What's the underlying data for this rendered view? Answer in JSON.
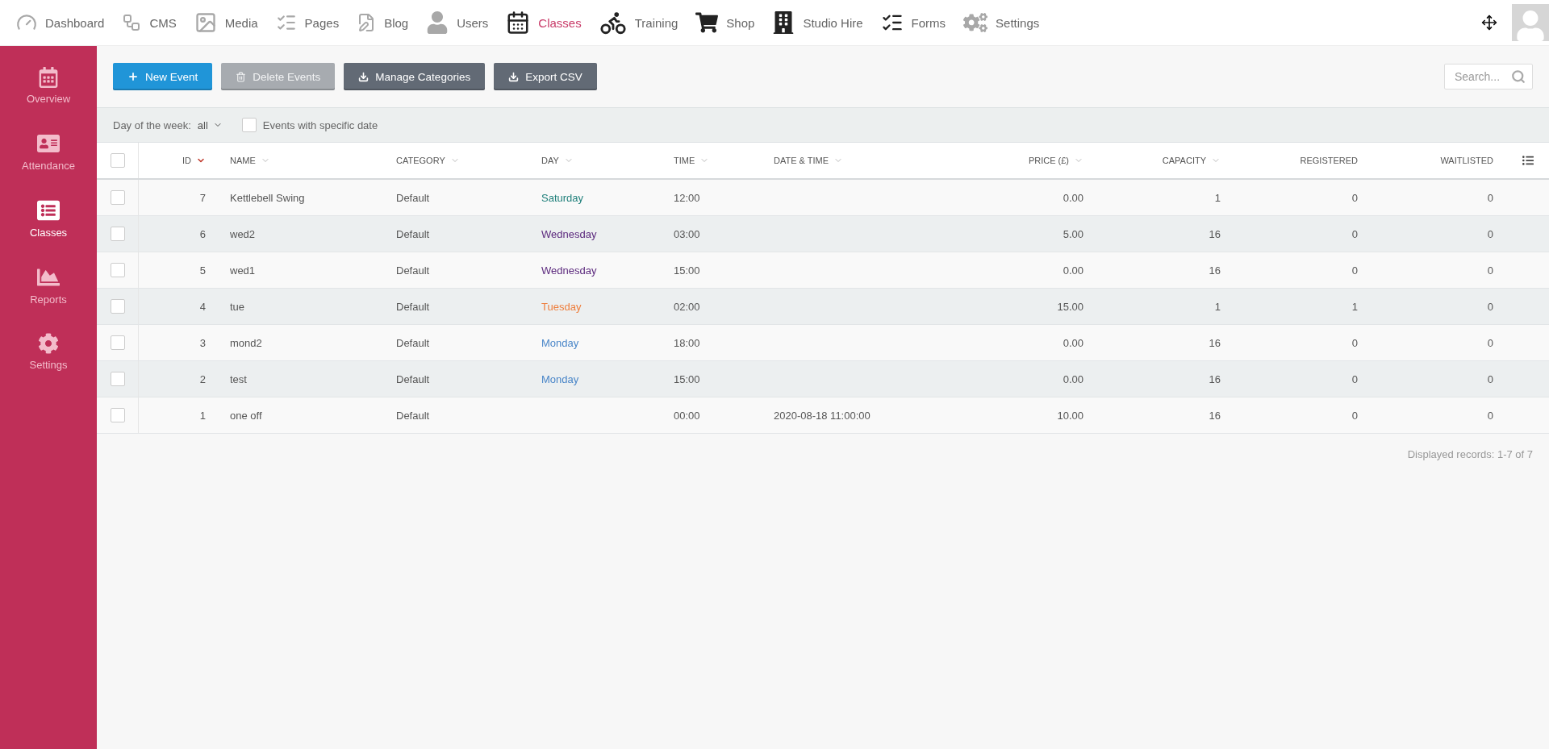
{
  "top_nav": {
    "items": [
      {
        "label": "Dashboard",
        "selected": false
      },
      {
        "label": "CMS",
        "selected": false
      },
      {
        "label": "Media",
        "selected": false
      },
      {
        "label": "Pages",
        "selected": false
      },
      {
        "label": "Blog",
        "selected": false
      },
      {
        "label": "Users",
        "selected": false
      },
      {
        "label": "Classes",
        "selected": true
      },
      {
        "label": "Training",
        "selected": false
      },
      {
        "label": "Shop",
        "selected": false
      },
      {
        "label": "Studio Hire",
        "selected": false
      },
      {
        "label": "Forms",
        "selected": false
      },
      {
        "label": "Settings",
        "selected": false
      }
    ]
  },
  "sidebar": {
    "items": [
      {
        "label": "Overview",
        "selected": false
      },
      {
        "label": "Attendance",
        "selected": false
      },
      {
        "label": "Classes",
        "selected": true
      },
      {
        "label": "Reports",
        "selected": false
      },
      {
        "label": "Settings",
        "selected": false
      }
    ]
  },
  "toolbar": {
    "buttons": [
      {
        "label": "New Event",
        "kind": "primary",
        "disabled": false
      },
      {
        "label": "Delete Events",
        "kind": "delete",
        "disabled": true
      },
      {
        "label": "Manage Categories",
        "kind": "download",
        "disabled": false
      },
      {
        "label": "Export CSV",
        "kind": "download",
        "disabled": false
      }
    ],
    "search": {
      "placeholder": "Search..."
    }
  },
  "filters": {
    "day_label": "Day of the week:",
    "day_value": "all",
    "specific_date": {
      "label": "Events with specific date",
      "checked": false
    }
  },
  "table": {
    "select_all": {
      "checked": false
    },
    "columns": [
      {
        "label": "ID",
        "sortable": true,
        "sorted": true
      },
      {
        "label": "NAME",
        "sortable": true,
        "sorted": false
      },
      {
        "label": "CATEGORY",
        "sortable": true,
        "sorted": false
      },
      {
        "label": "DAY",
        "sortable": true,
        "sorted": false
      },
      {
        "label": "TIME",
        "sortable": true,
        "sorted": false
      },
      {
        "label": "DATE & TIME",
        "sortable": true,
        "sorted": false
      },
      {
        "label": "PRICE (£)",
        "sortable": true,
        "sorted": false
      },
      {
        "label": "CAPACITY",
        "sortable": true,
        "sorted": false
      },
      {
        "label": "REGISTERED",
        "sortable": false,
        "sorted": false
      },
      {
        "label": "WAITLISTED",
        "sortable": false,
        "sorted": false
      }
    ],
    "rows": [
      {
        "checked": false,
        "id": "7",
        "name": "Kettlebell Swing",
        "category": "Default",
        "day": {
          "text": "Saturday",
          "color": "#1e7f7a"
        },
        "time": "12:00",
        "price": "0.00",
        "capacity": "1",
        "registered": "0",
        "waitlisted": "0"
      },
      {
        "checked": false,
        "id": "6",
        "name": "wed2",
        "category": "Default",
        "day": {
          "text": "Wednesday",
          "color": "#5c2a7e"
        },
        "time": "03:00",
        "price": "5.00",
        "capacity": "16",
        "registered": "0",
        "waitlisted": "0"
      },
      {
        "checked": false,
        "id": "5",
        "name": "wed1",
        "category": "Default",
        "day": {
          "text": "Wednesday",
          "color": "#5c2a7e"
        },
        "time": "15:00",
        "price": "0.00",
        "capacity": "16",
        "registered": "0",
        "waitlisted": "0"
      },
      {
        "checked": false,
        "id": "4",
        "name": "tue",
        "category": "Default",
        "day": {
          "text": "Tuesday",
          "color": "#ee7d3b"
        },
        "time": "02:00",
        "price": "15.00",
        "capacity": "1",
        "registered": "1",
        "waitlisted": "0"
      },
      {
        "checked": false,
        "id": "3",
        "name": "mond2",
        "category": "Default",
        "day": {
          "text": "Monday",
          "color": "#4a86c8"
        },
        "time": "18:00",
        "price": "0.00",
        "capacity": "16",
        "registered": "0",
        "waitlisted": "0"
      },
      {
        "checked": false,
        "id": "2",
        "name": "test",
        "category": "Default",
        "day": {
          "text": "Monday",
          "color": "#4a86c8"
        },
        "time": "15:00",
        "price": "0.00",
        "capacity": "16",
        "registered": "0",
        "waitlisted": "0"
      },
      {
        "checked": false,
        "id": "1",
        "name": "one off",
        "category": "Default",
        "time": "00:00",
        "datetime": "2020-08-18 11:00:00",
        "price": "10.00",
        "capacity": "16",
        "registered": "0",
        "waitlisted": "0"
      }
    ]
  },
  "footer": {
    "records": "Displayed records: 1-7 of 7"
  }
}
